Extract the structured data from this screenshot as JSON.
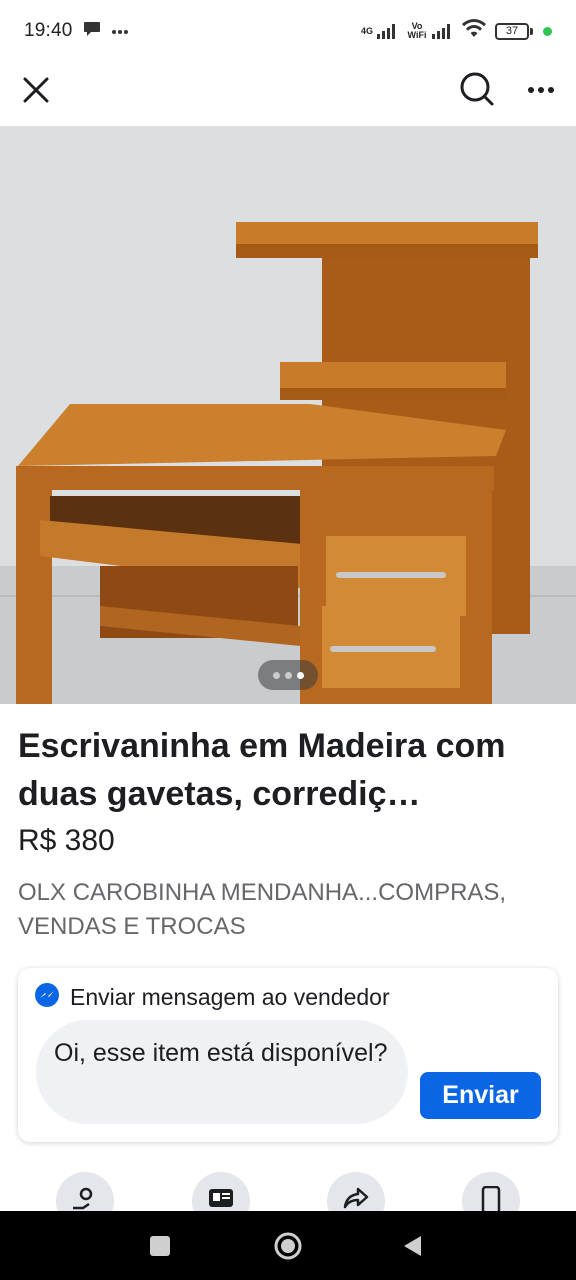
{
  "status_bar": {
    "time": "19:40",
    "left_icons": [
      "chat-bubble-icon",
      "more-dots-icon"
    ],
    "network_label_1": "4G",
    "network_label_2": "Vo\nWiFi",
    "battery_level": "37",
    "indicator_color": "#2dc653"
  },
  "app_bar": {
    "close_icon": "close-icon",
    "search_icon": "search-icon",
    "more_icon": "more-horizontal-icon"
  },
  "photo": {
    "description_icon": "desk-photo",
    "page_indicator": {
      "count": 3,
      "active_index": 2
    }
  },
  "listing": {
    "title": "Escrivaninha em Madeira com duas gavetas, corrediç…",
    "price": "R$ 380",
    "seller": "OLX CAROBINHA MENDANHA...COMPRAS, VENDAS E TROCAS"
  },
  "message_card": {
    "header_icon": "messenger-icon",
    "header_label": "Enviar mensagem ao vendedor",
    "input_value": "Oi, esse item está disponível?",
    "send_label": "Enviar",
    "accent_color": "#0a66e4"
  },
  "actions": {
    "icons": [
      "save-icon",
      "details-icon",
      "share-icon",
      "phone-icon"
    ]
  },
  "nav_bar": {
    "icons": [
      "recents-icon",
      "home-icon",
      "back-icon"
    ]
  }
}
